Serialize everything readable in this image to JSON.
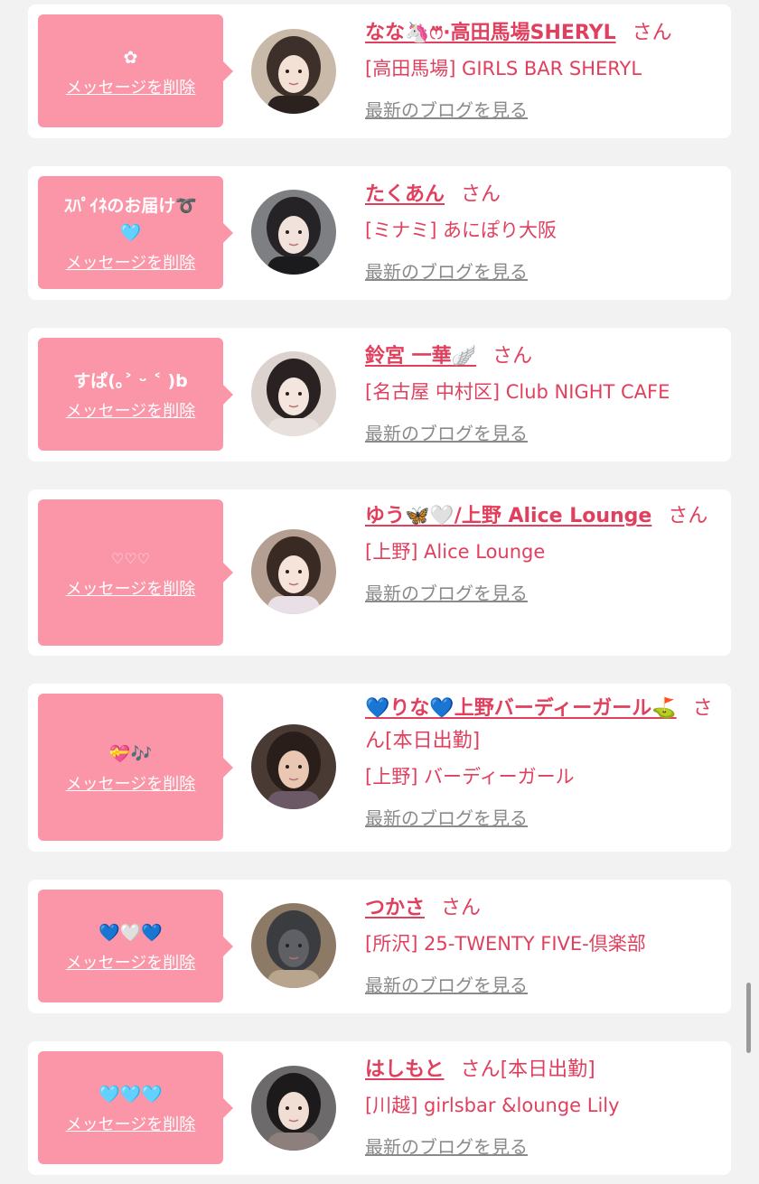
{
  "delete_label": "メッセージを削除",
  "blog_label": "最新のブログを見る",
  "honorific": "さん",
  "accent_color": "#e0405e",
  "bubble_color": "#fa96a8",
  "entries": [
    {
      "message": "✿",
      "name": "なな🦄ෆ⃛·高田馬場SHERYL",
      "status": "",
      "shop": "[高田馬場] GIRLS BAR SHERYL",
      "avatar_icon": "avatar-photo-icon",
      "avatar_colors": [
        "#c9b9a8",
        "#3d2f2a",
        "#f3e1d6",
        "#2b2220"
      ]
    },
    {
      "message": "ｽﾊﾟｲﾈのお届け➰\n🩵",
      "name": "たくあん",
      "status": "",
      "shop": "[ミナミ] あにぽり大阪",
      "avatar_icon": "avatar-photo-icon",
      "avatar_colors": [
        "#7d7f83",
        "#252325",
        "#f1e3dc",
        "#1b1a1c"
      ]
    },
    {
      "message": "すぱ(｡˃ ᵕ ˂ )b",
      "name": "鈴宮 一華🪽",
      "status": "",
      "shop": "[名古屋 中村区] Club NIGHT CAFE",
      "avatar_icon": "avatar-photo-icon",
      "avatar_colors": [
        "#dcd3cf",
        "#2a2222",
        "#f4e6df",
        "#e8e0dc"
      ]
    },
    {
      "message": "♡♡♡",
      "dim": true,
      "name": "ゆう🦋🤍/上野 Alice Lounge",
      "status": "",
      "shop": "[上野] Alice Lounge",
      "avatar_icon": "avatar-photo-icon",
      "avatar_colors": [
        "#b59f92",
        "#3a2a24",
        "#f6e4da",
        "#e9dfe6"
      ]
    },
    {
      "message": "💝🎶",
      "name": "💙りな💙上野バーディーガール⛳️",
      "status": "[本日出勤]",
      "shop": "[上野] バーディーガール",
      "avatar_icon": "avatar-photo-icon",
      "avatar_colors": [
        "#4a3a34",
        "#2a1e1a",
        "#e9c7b3",
        "#6b5a66"
      ]
    },
    {
      "message": "💙🤍💙",
      "name": "つかさ",
      "status": "",
      "shop": "[所沢] 25-TWENTY FIVE-倶楽部",
      "avatar_icon": "avatar-photo-icon",
      "avatar_colors": [
        "#8d7a66",
        "#3b3c40",
        "#5f6065",
        "#b9a58d"
      ]
    },
    {
      "message": "🩵🩵🩵",
      "name": "はしもと",
      "status": "[本日出勤]",
      "shop": "[川越] girlsbar &lounge Lily",
      "avatar_icon": "avatar-photo-icon",
      "avatar_colors": [
        "#6d6a6c",
        "#1d1a1c",
        "#f0ddd4",
        "#8c7f7c"
      ]
    }
  ]
}
